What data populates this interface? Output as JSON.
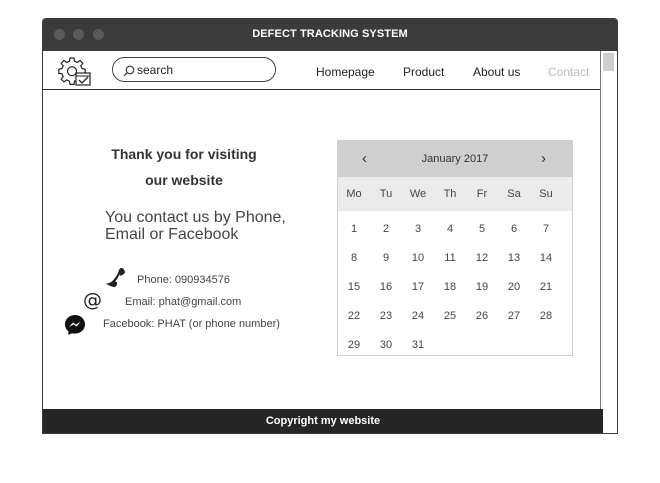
{
  "window": {
    "title": "DEFECT TRACKING SYSTEM"
  },
  "navbar": {
    "search": {
      "value": "search"
    },
    "links": [
      {
        "label": "Homepage",
        "disabled": false
      },
      {
        "label": "Product",
        "disabled": false
      },
      {
        "label": "About us",
        "disabled": false
      },
      {
        "label": "Contact",
        "disabled": true
      }
    ]
  },
  "content": {
    "heading_line1": "Thank you for visiting",
    "heading_line2": "our  website",
    "contact_line1": "You contact us by Phone,",
    "contact_line2": "Email or Facebook",
    "phone": "Phone: 090934576",
    "email": "Email: phat@gmail.com",
    "facebook": "Facebook: PHAT (or phone number)"
  },
  "calendar": {
    "prev_label": "‹",
    "next_label": "›",
    "month": "January 2017",
    "weekdays": [
      "Mo",
      "Tu",
      "We",
      "Th",
      "Fr",
      "Sa",
      "Su"
    ],
    "weeks": [
      [
        "1",
        "2",
        "3",
        "4",
        "5",
        "6",
        "7"
      ],
      [
        "8",
        "9",
        "10",
        "11",
        "12",
        "13",
        "14"
      ],
      [
        "15",
        "16",
        "17",
        "18",
        "19",
        "20",
        "21"
      ],
      [
        "22",
        "23",
        "24",
        "25",
        "26",
        "27",
        "28"
      ],
      [
        "29",
        "30",
        "31",
        "",
        "",
        "",
        ""
      ]
    ]
  },
  "footer": {
    "text": "Copyright my website"
  },
  "icons": {
    "settings": "gear-checklist-icon",
    "search": "magnifier-icon",
    "phone": "phone-icon",
    "email": "at-sign-icon",
    "facebook": "messenger-icon"
  }
}
